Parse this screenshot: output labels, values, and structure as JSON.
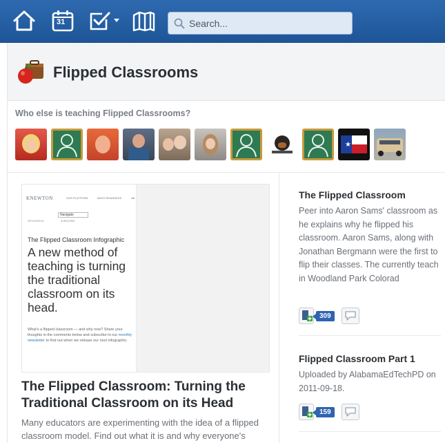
{
  "topbar": {
    "icons": [
      "home-icon",
      "calendar-icon",
      "tasks-icon",
      "library-icon"
    ],
    "calendar_day": "31",
    "search": {
      "placeholder": "Search..."
    }
  },
  "page": {
    "title": "Flipped Classrooms",
    "icon": "apple-briefcase-icon"
  },
  "who": {
    "label": "Who else is teaching Flipped Classrooms?",
    "avatars": [
      "photo",
      "placeholder",
      "photo",
      "photo",
      "photo",
      "photo",
      "placeholder",
      "photo",
      "placeholder",
      "photo",
      "photo"
    ]
  },
  "thumbnail": {
    "logo": "KNEWTON",
    "nav": [
      "OUR PLATFORM",
      "MATH READINESS",
      "AB"
    ],
    "select_value": "Navigate",
    "tabs": [
      "INFOGRAPHIC",
      "SUBSCRIBE"
    ],
    "subtitle": "The Flipped Classroom Infographic",
    "headline": "A new method of teaching is turning the traditional classroom on its head.",
    "body_before_link": "What's a flipped classroom — and why now? Share your thoughts in the comments below and subscribe to our ",
    "body_link": "monthly newsletter",
    "body_after_link": " to find out when we release our next infographic."
  },
  "article": {
    "title": "The Flipped Classroom: Turning the Traditional Classroom on its Head",
    "description": "Many educators are experimenting with the idea of a flipped classroom model. Find out what it is and why everyone's"
  },
  "resources": [
    {
      "title": "The Flipped Classroom",
      "description": "Peer into Aaron Sams' classroom as he explains why he flipped his classroom. Aaron Sams, along with Jonathan Bergmann were the first to flip their classes. The currently teach in Woodland Park Colorad",
      "count": "309"
    },
    {
      "title": "Flipped Classroom Part 1",
      "description": "Uploaded by AlabamaEdTechPD on 2011-09-18.",
      "count": "159"
    }
  ],
  "colors": {
    "topbar": "#1d5597",
    "accent": "#2f64b1",
    "placeholder_avatar_bg": "#2e7a52",
    "placeholder_avatar_border": "#c89a3a"
  }
}
